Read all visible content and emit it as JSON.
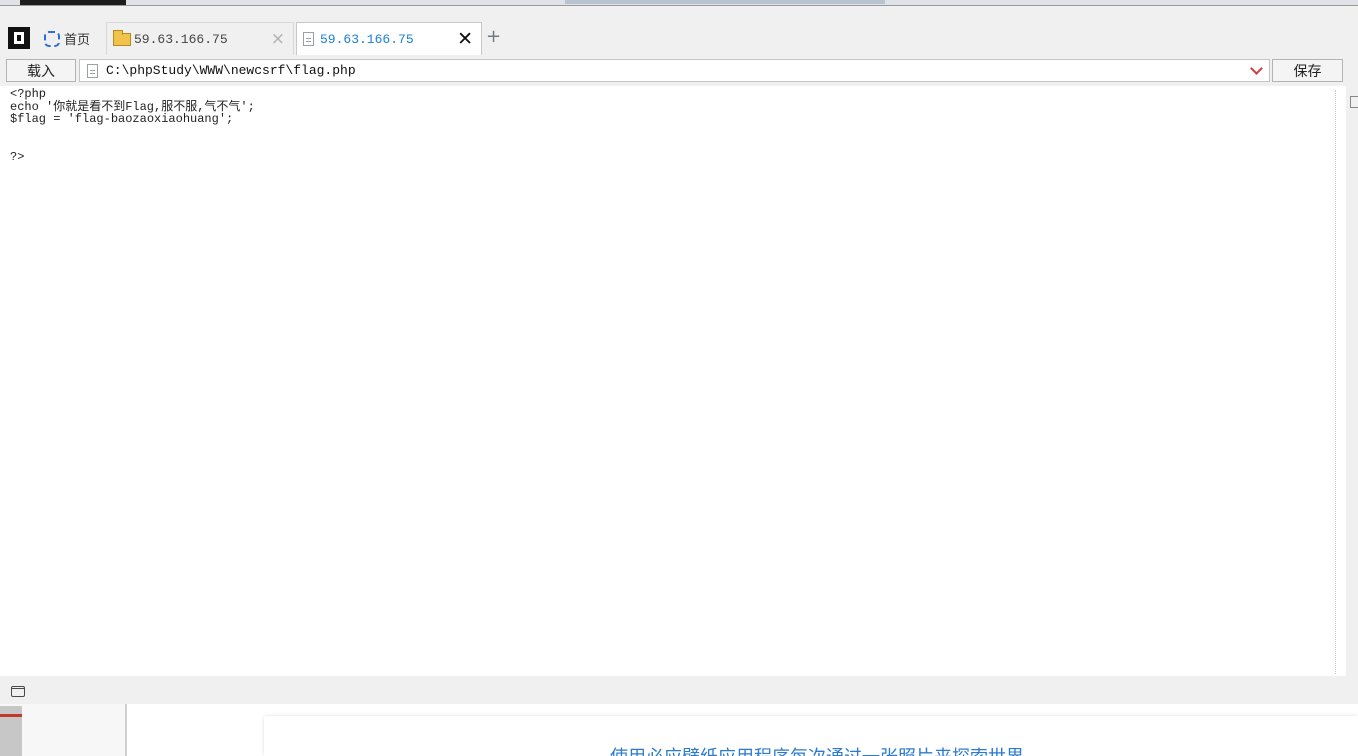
{
  "tabs": {
    "home_label": "首页",
    "tab1_label": "59.63.166.75",
    "tab2_label": "59.63.166.75",
    "close_glyph": "×",
    "active_close_glyph": "✕",
    "new_tab_glyph": "+"
  },
  "toolbar": {
    "load_label": "载入",
    "path": "C:\\phpStudy\\WWW\\newcsrf\\flag.php",
    "save_label": "保存"
  },
  "editor": {
    "lines": [
      "<?php",
      "echo '你就是看不到Flag,服不服,气不气';",
      "$flag = 'flag-baozaoxiaohuang';",
      "",
      "",
      "?>"
    ]
  },
  "background_page": {
    "banner_text": "使用必应壁纸应用程序每次通过一张照片来探索世界"
  },
  "colors": {
    "active_tab_text": "#1a7fd4",
    "dropdown_arrow": "#d23b3b",
    "folder": "#f1c34b"
  }
}
